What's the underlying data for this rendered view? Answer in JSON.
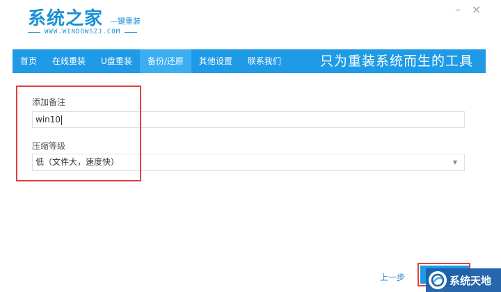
{
  "header": {
    "logo_title": "系统之家",
    "logo_tagline": "—键重装",
    "logo_url": "WWW.WINDOWSZJ.COM"
  },
  "window_controls": {
    "minimize": "–",
    "close": "×"
  },
  "nav": {
    "items": [
      {
        "label": "首页",
        "active": false
      },
      {
        "label": "在线重装",
        "active": false
      },
      {
        "label": "U盘重装",
        "active": false
      },
      {
        "label": "备份/还原",
        "active": true
      },
      {
        "label": "其他设置",
        "active": false
      },
      {
        "label": "联系我们",
        "active": false
      }
    ],
    "slogan": "只为重装系统而生的工具"
  },
  "form": {
    "note_label": "添加备注",
    "note_value": "win10",
    "compress_label": "压缩等级",
    "compress_value": "低（文件大，速度快）"
  },
  "footer": {
    "prev_label": "上一步"
  },
  "watermark": {
    "text": "系统天地"
  },
  "colors": {
    "accent": "#1e9ae6",
    "active_tab": "#3aaef0",
    "highlight": "#e04040"
  }
}
